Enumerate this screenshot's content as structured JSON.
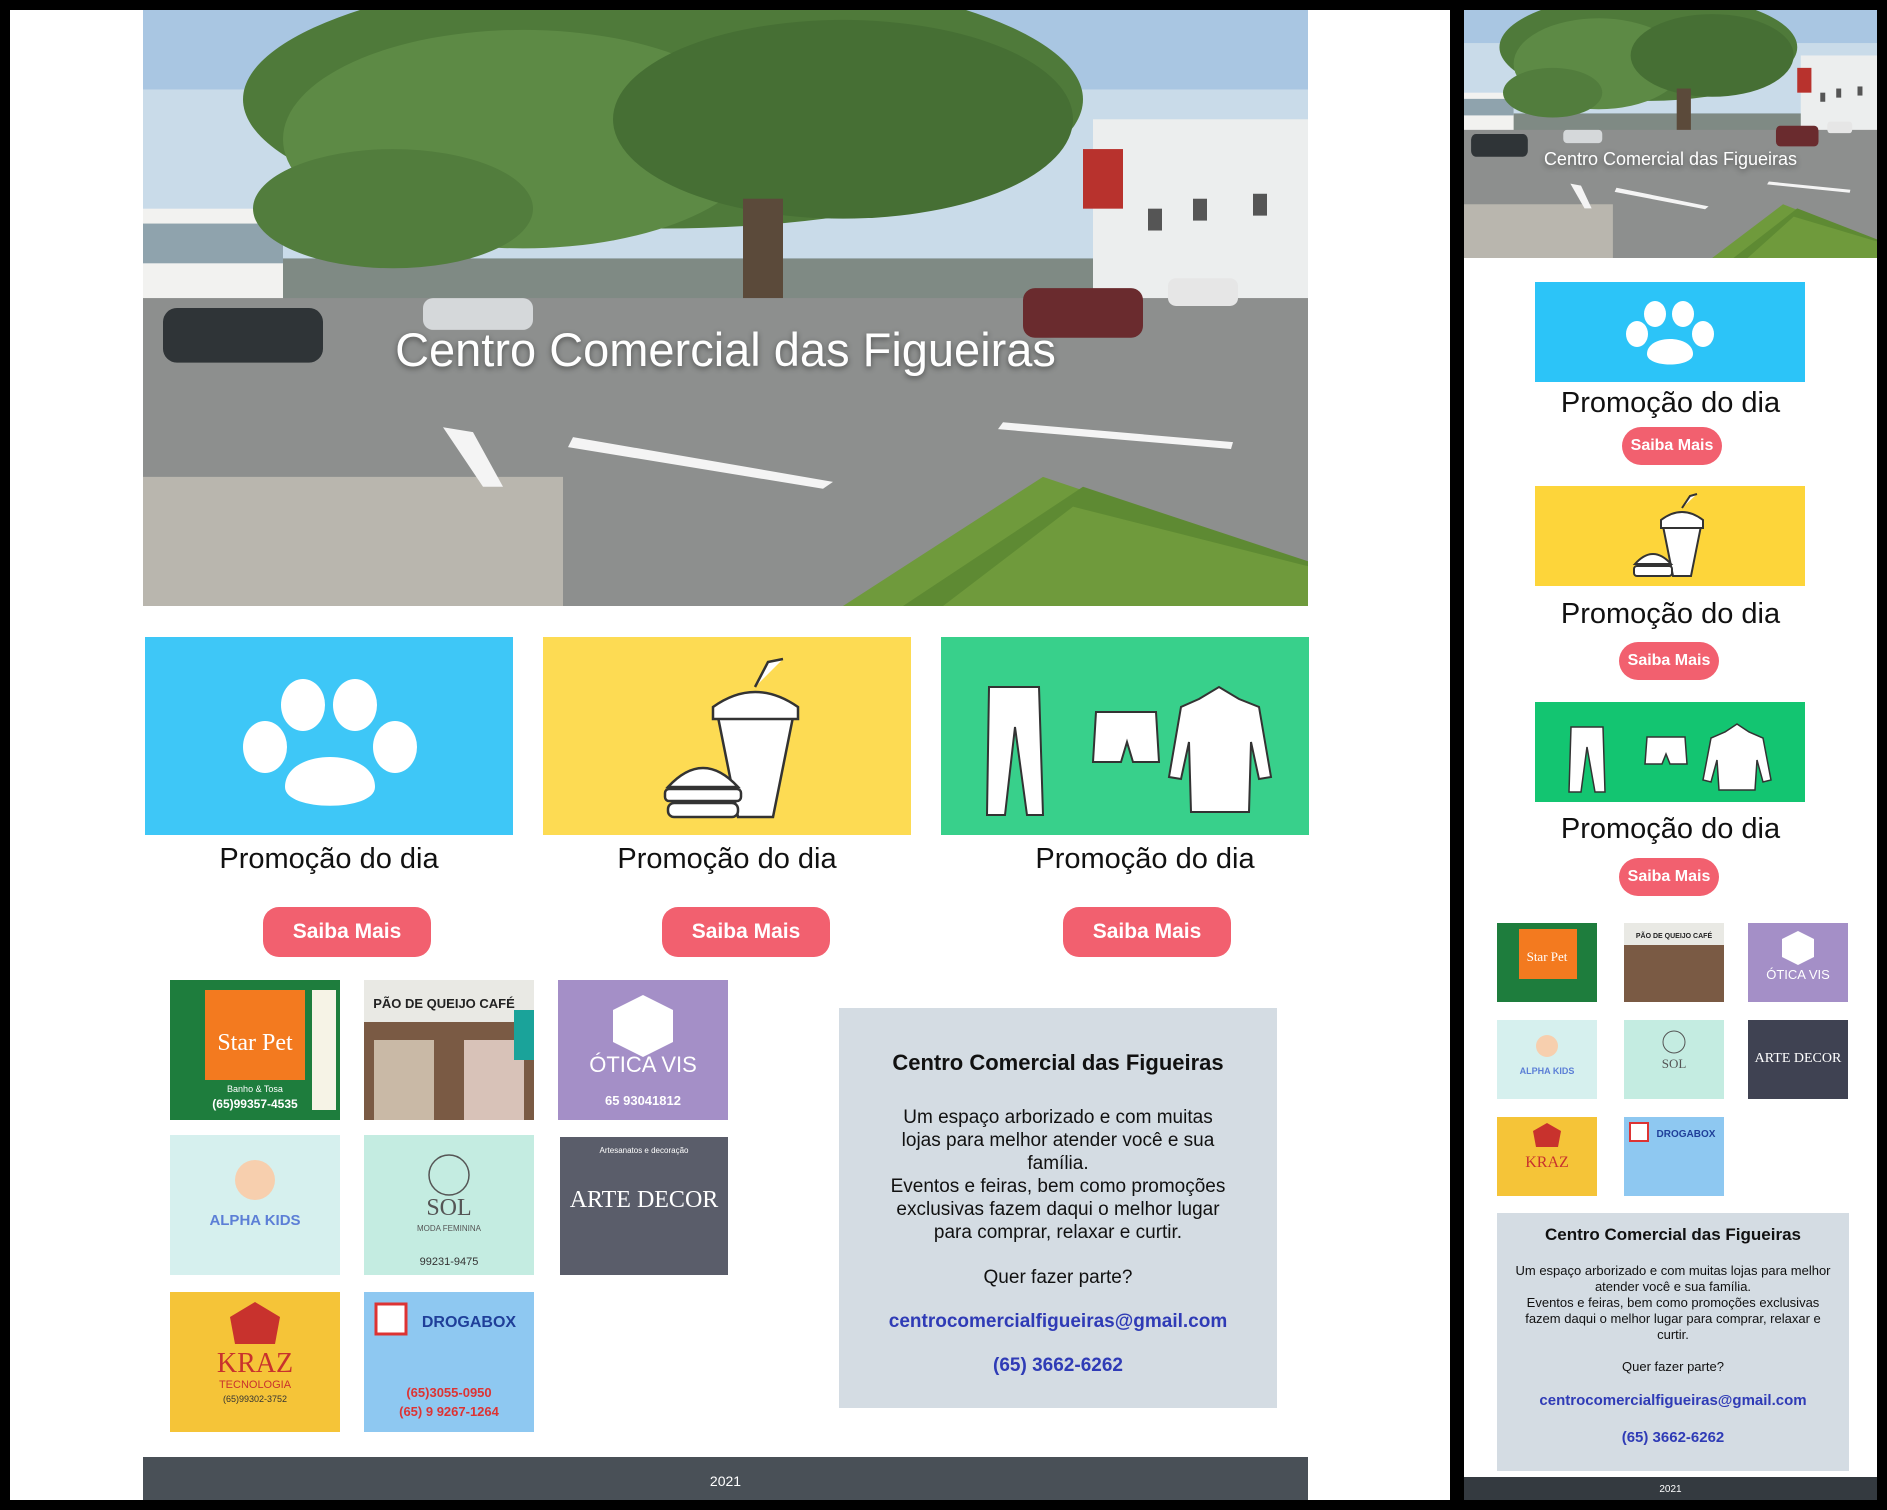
{
  "site": {
    "title": "Centro Comercial das Figueiras"
  },
  "promos": [
    {
      "label": "Promoção do dia",
      "button": "Saiba Mais",
      "color": "#3ec7f7",
      "icon": "paw-icon"
    },
    {
      "label": "Promoção do dia",
      "button": "Saiba Mais",
      "color": "#fddb53",
      "icon": "burger-drink-icon"
    },
    {
      "label": "Promoção do dia",
      "button": "Saiba Mais",
      "color": "#38d08b",
      "icon": "clothes-icon"
    }
  ],
  "stores": [
    {
      "name": "Star Pet",
      "lines": [
        "Banho & Tosa",
        "(65)99357-4535"
      ]
    },
    {
      "name": "PÃO DE QUEIJO CAFÉ",
      "lines": []
    },
    {
      "name": "ÓTICA VIS",
      "lines": [
        "65 93041812"
      ]
    },
    {
      "name": "ALPHA KIDS",
      "lines": []
    },
    {
      "name": "SOL",
      "lines": [
        "MODA FEMININA",
        "99231-9475"
      ]
    },
    {
      "name": "ARTE DECOR",
      "lines": [
        "Artesanatos e decoração"
      ]
    },
    {
      "name": "KRAZ",
      "lines": [
        "TECNOLOGIA",
        "(65)99302-3752"
      ]
    },
    {
      "name": "DROGABOX",
      "lines": [
        "(65)3055-0950",
        "(65) 9 9267-1264"
      ]
    }
  ],
  "info": {
    "heading": "Centro Comercial das Figueiras",
    "description_1": "Um espaço arborizado e com muitas lojas para melhor atender você e sua família.",
    "description_2": "Eventos e feiras, bem como promoções exclusivas fazem daqui o melhor lugar para comprar, relaxar e curtir.",
    "question": "Quer fazer parte?",
    "email": "centrocomercialfigueiras@gmail.com",
    "phone": "(65) 3662-6262"
  },
  "footer": {
    "year": "2021"
  },
  "colors": {
    "button": "#f2606f",
    "info_bg": "#d4dce3",
    "footer_bg": "#495057",
    "link": "#2f3bb6"
  }
}
